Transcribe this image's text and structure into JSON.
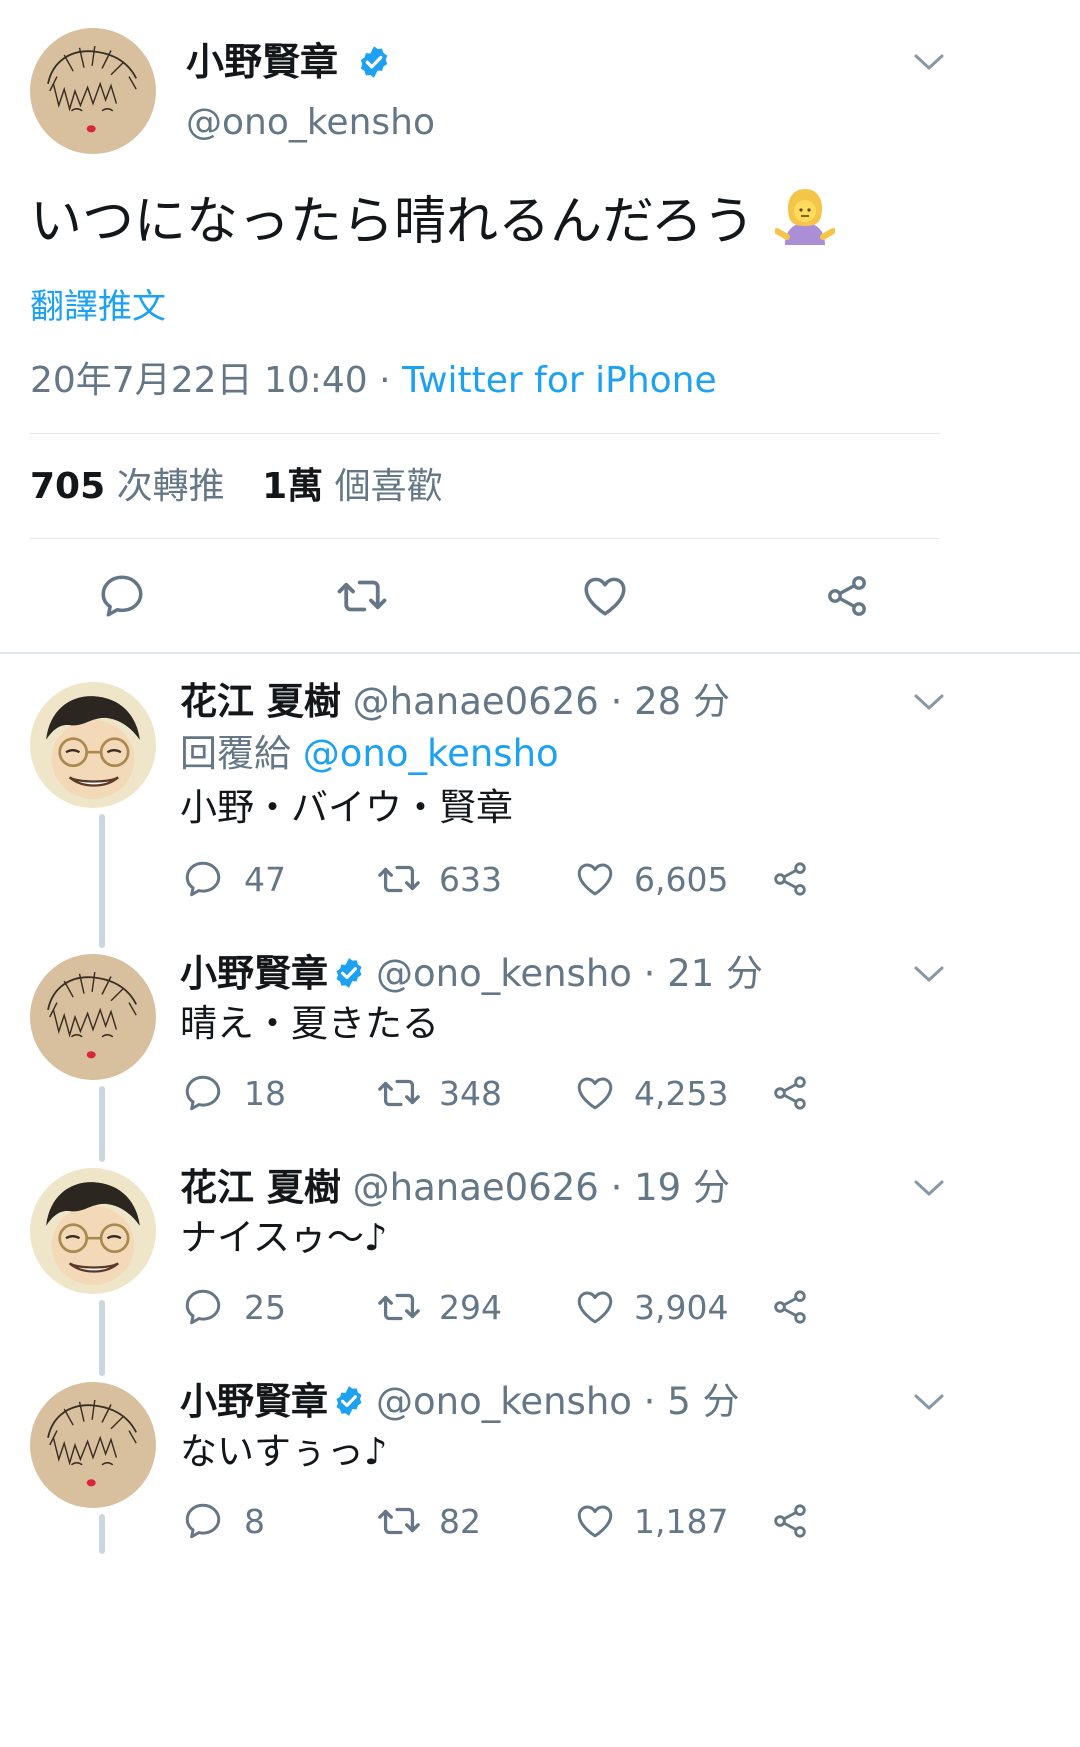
{
  "main_tweet": {
    "display_name": "小野賢章",
    "handle": "@ono_kensho",
    "text": "いつになったら晴れるんだろう",
    "translate_label": "翻譯推文",
    "date": "20年7月22日 10:40",
    "separator": " · ",
    "source": "Twitter for iPhone",
    "retweet_count": "705",
    "retweet_label": "次轉推",
    "like_count": "1萬",
    "like_label": "個喜歡"
  },
  "replies": [
    {
      "display_name": "花江 夏樹",
      "handle": "@hanae0626",
      "time": " · 28 分",
      "reply_prefix": "回覆給",
      "reply_to": "@ono_kensho",
      "text": "小野・バイウ・賢章",
      "replies": "47",
      "retweets": "633",
      "likes": "6,605"
    },
    {
      "display_name": "小野賢章",
      "handle": "@ono_kensho",
      "time": " · 21 分",
      "text": "晴え・夏きたる",
      "replies": "18",
      "retweets": "348",
      "likes": "4,253"
    },
    {
      "display_name": "花江 夏樹",
      "handle": "@hanae0626",
      "time": " · 19 分",
      "text": "ナイスゥ〜♪",
      "replies": "25",
      "retweets": "294",
      "likes": "3,904"
    },
    {
      "display_name": "小野賢章",
      "handle": "@ono_kensho",
      "time": " · 5 分",
      "text": "ないすぅっ♪",
      "replies": "8",
      "retweets": "82",
      "likes": "1,187"
    }
  ],
  "icons": {
    "chevron": "chevron-down-icon",
    "verified": "verified-badge-icon",
    "reply": "reply-icon",
    "retweet": "retweet-icon",
    "like": "heart-icon",
    "share": "share-icon",
    "emoji": "person-shrugging-emoji"
  },
  "colors": {
    "accent": "#1da1f2",
    "secondary_text": "#657786",
    "thread_line": "#ccd6dd"
  }
}
